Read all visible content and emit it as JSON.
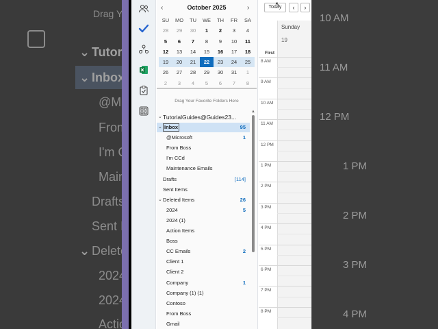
{
  "background_left": {
    "drag_text": "Drag Y",
    "items": [
      "Tutor",
      "Inbox",
      "@Mic",
      "From",
      "I'm C",
      "Main",
      "Drafts",
      "Sent It",
      "Delete",
      "2024",
      "2024",
      "Actio"
    ]
  },
  "background_right": {
    "times": [
      "10 AM",
      "11 AM",
      "12 PM",
      "1 PM",
      "2 PM",
      "3 PM",
      "4 PM"
    ]
  },
  "mini_calendar": {
    "month_title": "October 2025",
    "prev": "‹",
    "next": "›",
    "weekdays": [
      "SU",
      "MO",
      "TU",
      "WE",
      "TH",
      "FR",
      "SA"
    ],
    "weeks": [
      [
        "28",
        "29",
        "30",
        "1",
        "2",
        "3",
        "4"
      ],
      [
        "5",
        "6",
        "7",
        "8",
        "9",
        "10",
        "11"
      ],
      [
        "12",
        "13",
        "14",
        "15",
        "16",
        "17",
        "18"
      ],
      [
        "19",
        "20",
        "21",
        "22",
        "23",
        "24",
        "25"
      ],
      [
        "26",
        "27",
        "28",
        "29",
        "30",
        "31",
        "1"
      ],
      [
        "2",
        "3",
        "4",
        "5",
        "6",
        "7",
        "8"
      ]
    ],
    "today": "22"
  },
  "drag_hint": "Drag Your Favorite Folders Here",
  "account": "TutorialGuides@Guides23...",
  "folders": [
    {
      "label": "Inbox",
      "count": "95"
    },
    {
      "label": "@Microsoft",
      "count": "1"
    },
    {
      "label": "From Boss",
      "count": ""
    },
    {
      "label": "I'm CCd",
      "count": ""
    },
    {
      "label": "Maintenance Emails",
      "count": ""
    },
    {
      "label": "Drafts",
      "count": "[114]"
    },
    {
      "label": "Sent Items",
      "count": ""
    },
    {
      "label": "Deleted Items",
      "count": "26"
    },
    {
      "label": "2024",
      "count": "5"
    },
    {
      "label": "2024 (1)",
      "count": ""
    },
    {
      "label": "Action Items",
      "count": ""
    },
    {
      "label": "Boss",
      "count": ""
    },
    {
      "label": "CC Emails",
      "count": "2"
    },
    {
      "label": "Client 1",
      "count": ""
    },
    {
      "label": "Client 2",
      "count": ""
    },
    {
      "label": "Company",
      "count": "1"
    },
    {
      "label": "Company (1) (1)",
      "count": ""
    },
    {
      "label": "Contoso",
      "count": ""
    },
    {
      "label": "From Boss",
      "count": ""
    },
    {
      "label": "Gmail",
      "count": ""
    }
  ],
  "day_view": {
    "today_label": "Today",
    "prev": "‹",
    "next": "›",
    "day_name": "Sunday",
    "day_number": "19",
    "first_label": "First",
    "times": [
      "8 AM",
      "9 AM",
      "10 AM",
      "11 AM",
      "12 PM",
      "1 PM",
      "2 PM",
      "3 PM",
      "4 PM",
      "5 PM",
      "6 PM",
      "7 PM",
      "8 PM"
    ]
  },
  "rail_icons": [
    "people-icon",
    "todo-check-icon",
    "groups-icon",
    "excel-icon",
    "tasks-clipboard-icon",
    "apps-grid-icon"
  ],
  "colors": {
    "accent": "#0f6cbd",
    "selection": "#cfe2f5",
    "week_highlight": "#d6e6f4"
  }
}
